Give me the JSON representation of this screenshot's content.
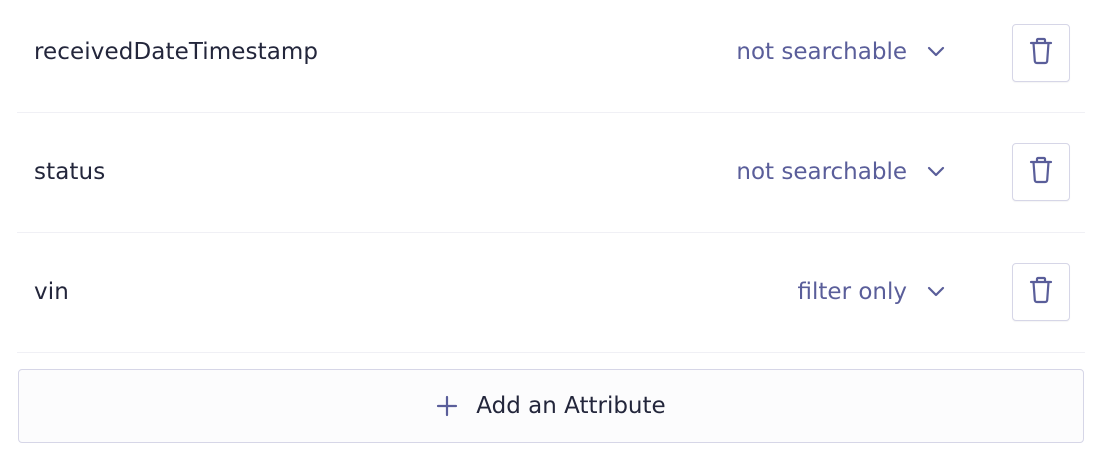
{
  "attributes": [
    {
      "name": "receivedDateTimestamp",
      "mode": "not searchable"
    },
    {
      "name": "status",
      "mode": "not searchable"
    },
    {
      "name": "vin",
      "mode": "filter only"
    }
  ],
  "icons": {
    "mode_dropdown": "chevron-down-icon",
    "delete": "trash-icon",
    "add": "plus-icon"
  },
  "add_button": {
    "label": "Add an Attribute"
  },
  "colors": {
    "accent": "#5a5e9a",
    "text": "#23263b",
    "border": "#d6d6e7"
  }
}
